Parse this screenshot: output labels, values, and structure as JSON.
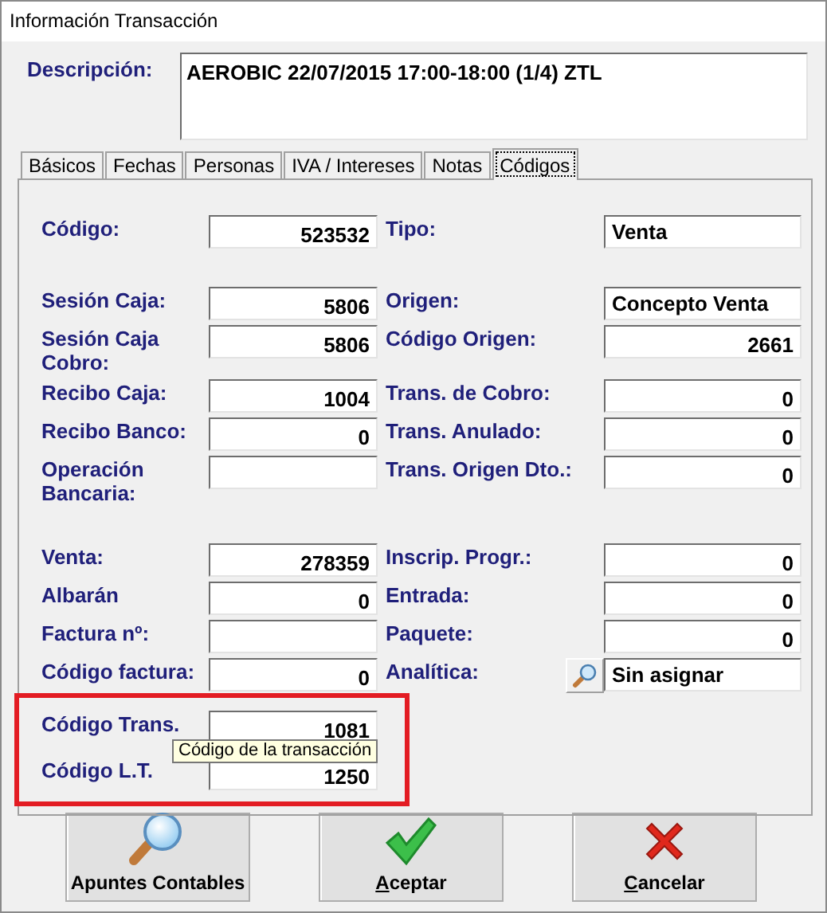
{
  "window": {
    "title": "Información Transacción"
  },
  "description": {
    "label": "Descripción:",
    "value": "AEROBIC 22/07/2015 17:00-18:00 (1/4) ZTL"
  },
  "tabs": [
    {
      "label": "Básicos",
      "selected": false
    },
    {
      "label": "Fechas",
      "selected": false
    },
    {
      "label": "Personas",
      "selected": false
    },
    {
      "label": "IVA / Intereses",
      "selected": false
    },
    {
      "label": "Notas",
      "selected": false
    },
    {
      "label": "Códigos",
      "selected": true
    }
  ],
  "groups": [
    {
      "highlighted": false,
      "rows": [
        {
          "left": {
            "label": "Código:",
            "value": "523532",
            "kind": "number"
          },
          "right": {
            "label": "Tipo:",
            "value": "Venta",
            "kind": "text"
          }
        }
      ]
    },
    {
      "highlighted": false,
      "rows": [
        {
          "left": {
            "label": "Sesión Caja:",
            "value": "5806",
            "kind": "number"
          },
          "right": {
            "label": "Origen:",
            "value": "Concepto Venta",
            "kind": "text"
          }
        },
        {
          "left": {
            "label": "Sesión Caja Cobro:",
            "value": "5806",
            "kind": "number"
          },
          "right": {
            "label": "Código Origen:",
            "value": "2661",
            "kind": "number"
          }
        },
        {
          "left": {
            "label": "Recibo Caja:",
            "value": "1004",
            "kind": "number"
          },
          "right": {
            "label": "Trans. de Cobro:",
            "value": "0",
            "kind": "number"
          }
        },
        {
          "left": {
            "label": "Recibo Banco:",
            "value": "0",
            "kind": "number"
          },
          "right": {
            "label": "Trans. Anulado:",
            "value": "0",
            "kind": "number"
          }
        },
        {
          "left": {
            "label": "Operación Bancaria:",
            "kind": "number"
          },
          "right": {
            "label": "Trans. Origen Dto.:",
            "value": "0",
            "kind": "number"
          }
        }
      ]
    },
    {
      "highlighted": false,
      "rows": [
        {
          "left": {
            "label": "Venta:",
            "value": "278359",
            "kind": "number"
          },
          "right": {
            "label": "Inscrip. Progr.:",
            "value": "0",
            "kind": "number"
          }
        },
        {
          "left": {
            "label": "Albarán",
            "value": "0",
            "kind": "number"
          },
          "right": {
            "label": "Entrada:",
            "value": "0",
            "kind": "number"
          }
        },
        {
          "left": {
            "label": "Factura nº:",
            "kind": "number"
          },
          "right": {
            "label": "Paquete:",
            "value": "0",
            "kind": "number"
          }
        },
        {
          "left": {
            "label": "Código factura:",
            "value": "0",
            "kind": "number"
          },
          "right": {
            "label": "Analítica:",
            "value": "Sin asignar",
            "kind": "lookup"
          }
        }
      ]
    },
    {
      "highlighted": true,
      "rows": [
        {
          "left": {
            "label": "Código Trans.",
            "value": "1081",
            "kind": "number"
          }
        },
        {
          "left": {
            "label": "Código L.T.",
            "value": "1250",
            "kind": "number"
          }
        }
      ]
    }
  ],
  "tooltip": {
    "text": "Código de la transacción"
  },
  "buttons": [
    {
      "label": "Apuntes Contables",
      "underline_first": false
    },
    {
      "label": "Aceptar",
      "underline_first": true
    },
    {
      "label": "Cancelar",
      "underline_first": true
    }
  ]
}
